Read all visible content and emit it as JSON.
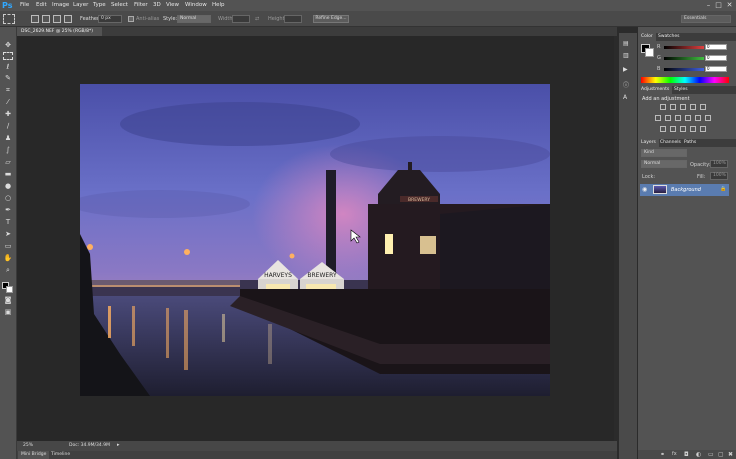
{
  "app": {
    "logo": "Ps"
  },
  "menu": [
    "File",
    "Edit",
    "Image",
    "Layer",
    "Type",
    "Select",
    "Filter",
    "3D",
    "View",
    "Window",
    "Help"
  ],
  "window_controls": [
    "–",
    "□",
    "✕"
  ],
  "options_bar": {
    "feather_label": "Feather:",
    "feather_value": "0 px",
    "antialias_label": "Anti-alias",
    "style_label": "Style:",
    "style_value": "Normal",
    "width_label": "Width:",
    "height_label": "Height:",
    "refine_edge": "Refine Edge...",
    "workspace": "Essentials"
  },
  "document": {
    "tab_title": "DSC_2629.NEF @ 25% (RGB/8*)"
  },
  "status_bar": {
    "zoom": "25%",
    "doc": "Doc: 34.9M/34.9M"
  },
  "bottom_tabs": [
    "Mini Bridge",
    "Timeline"
  ],
  "color_panel": {
    "tabs": [
      "Color",
      "Swatches"
    ],
    "channels": [
      {
        "label": "R",
        "value": "0",
        "color": "#e04040"
      },
      {
        "label": "G",
        "value": "0",
        "color": "#40c040"
      },
      {
        "label": "B",
        "value": "0",
        "color": "#4060e0"
      }
    ]
  },
  "adjustments_panel": {
    "tabs": [
      "Adjustments",
      "Styles"
    ],
    "heading": "Add an adjustment"
  },
  "layers_panel": {
    "tabs": [
      "Layers",
      "Channels",
      "Paths"
    ],
    "kind": "Kind",
    "blend_mode": "Normal",
    "opacity_label": "Opacity:",
    "opacity_value": "100%",
    "lock_label": "Lock:",
    "fill_label": "Fill:",
    "fill_value": "100%",
    "layer_name": "Background"
  },
  "photo": {
    "sign1": "HARVEYS",
    "sign2": "BREWERY",
    "sign3": "BREWERY"
  },
  "colors": {
    "accent": "#31a8ff",
    "ui_dark": "#535353",
    "selection": "#5a7cb0"
  }
}
